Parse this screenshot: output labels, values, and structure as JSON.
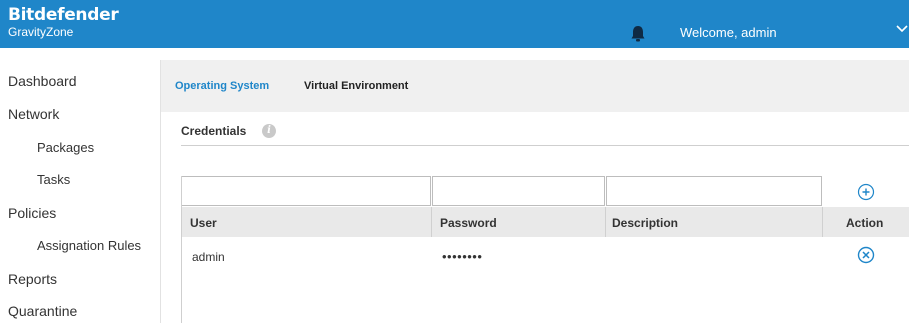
{
  "header": {
    "brand": "Bitdefender",
    "product": "GravityZone",
    "welcome": "Welcome, admin",
    "icons": {
      "notifications": "bell-icon",
      "menu": "chevron-down-icon"
    },
    "color": "#1f86c9"
  },
  "sidebar": {
    "items": [
      {
        "label": "Dashboard",
        "level": 0
      },
      {
        "label": "Network",
        "level": 0
      },
      {
        "label": "Packages",
        "level": 1
      },
      {
        "label": "Tasks",
        "level": 1
      },
      {
        "label": "Policies",
        "level": 0
      },
      {
        "label": "Assignation Rules",
        "level": 1
      },
      {
        "label": "Reports",
        "level": 0
      },
      {
        "label": "Quarantine",
        "level": 0
      }
    ]
  },
  "tabs": [
    {
      "label": "Operating System",
      "active": true
    },
    {
      "label": "Virtual Environment",
      "active": false
    }
  ],
  "credentials": {
    "title": "Credentials",
    "inputs": {
      "user": "",
      "password": "",
      "description": ""
    },
    "add_icon": "plus-circle-icon",
    "columns": [
      "User",
      "Password",
      "Description",
      "Action"
    ],
    "rows": [
      {
        "user": "admin",
        "password": "••••••••",
        "description": "",
        "action_icon": "remove-circle-icon"
      }
    ]
  }
}
